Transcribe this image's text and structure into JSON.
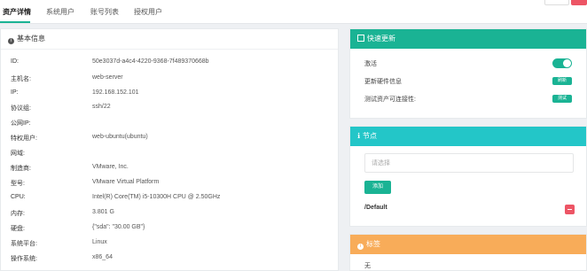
{
  "tabs": [
    {
      "label": "资产详情",
      "active": true
    },
    {
      "label": "系统用户",
      "active": false
    },
    {
      "label": "账号列表",
      "active": false
    },
    {
      "label": "授权用户",
      "active": false
    }
  ],
  "basic": {
    "title": "基本信息",
    "rows": [
      {
        "label": "ID:",
        "value": "50e3037d-a4c4-4220-9368-7f489370668b"
      },
      {
        "label": "主机名:",
        "value": "web-server"
      },
      {
        "label": "IP:",
        "value": "192.168.152.101"
      },
      {
        "label": "协议组:",
        "value": "ssh/22"
      },
      {
        "label": "公网IP:",
        "value": ""
      },
      {
        "label": "特权用户:",
        "value": "web-ubuntu(ubuntu)"
      },
      {
        "label": "网域:",
        "value": ""
      },
      {
        "label": "制造商:",
        "value": "VMware, Inc."
      },
      {
        "label": "型号:",
        "value": "VMware Virtual Platform"
      },
      {
        "label": "CPU:",
        "value": "Intel(R) Core(TM) i5-10300H CPU @ 2.50GHz"
      },
      {
        "label": "内存:",
        "value": "3.801 G"
      },
      {
        "label": "硬盘:",
        "value": "{\"sda\": \"30.00 GB\"}"
      },
      {
        "label": "系统平台:",
        "value": "Linux"
      },
      {
        "label": "操作系统:",
        "value": "x86_64"
      }
    ]
  },
  "quick": {
    "title": "快速更新",
    "rows": [
      {
        "label": "激活"
      },
      {
        "label": "更新硬件信息",
        "button": "刷新"
      },
      {
        "label": "测试资产可连接性:",
        "button": "测试"
      }
    ]
  },
  "nodes": {
    "title": "节点",
    "select_placeholder": "请选择",
    "add_label": "添加",
    "items": [
      "/Default"
    ]
  },
  "labels": {
    "title": "标签",
    "empty_text": "无"
  },
  "colors": {
    "green": "#1ab394",
    "teal": "#23c6c8",
    "orange": "#f8ac59",
    "red": "#ed5565"
  }
}
